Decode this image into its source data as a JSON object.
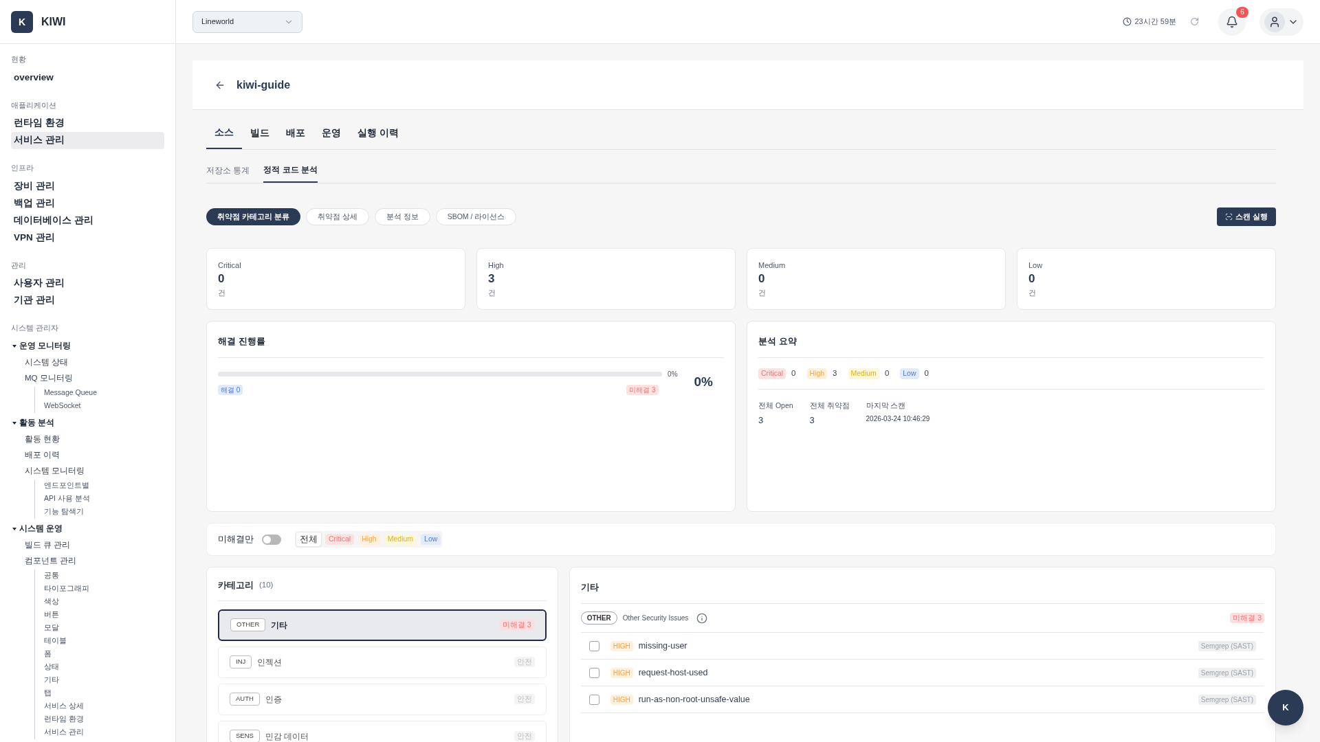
{
  "brand": {
    "logo": "K",
    "name": "KIWI"
  },
  "sidebar": [
    {
      "title": "현황",
      "items": [
        {
          "label": "overview",
          "selected": false
        }
      ]
    },
    {
      "title": "애플리케이션",
      "items": [
        {
          "label": "런타임 환경",
          "selected": false
        },
        {
          "label": "서비스 관리",
          "selected": true
        }
      ]
    },
    {
      "title": "인프라",
      "items": [
        {
          "label": "장비 관리",
          "selected": false
        },
        {
          "label": "백업 관리",
          "selected": false
        },
        {
          "label": "데이터베이스 관리",
          "selected": false
        },
        {
          "label": "VPN 관리",
          "selected": false
        }
      ]
    },
    {
      "title": "관리",
      "items": [
        {
          "label": "사용자 관리",
          "selected": false
        },
        {
          "label": "기관 관리",
          "selected": false
        }
      ]
    },
    {
      "title": "시스템 관리자",
      "groups": [
        {
          "label": "운영 모니터링",
          "expanded": true,
          "children": [
            {
              "label": "시스템 상태"
            },
            {
              "label": "MQ 모니터링",
              "children": [
                {
                  "label": "Message Queue"
                },
                {
                  "label": "WebSocket"
                }
              ]
            }
          ]
        },
        {
          "label": "활동 분석",
          "expanded": true,
          "children": [
            {
              "label": "활동 현황"
            },
            {
              "label": "배포 이력"
            },
            {
              "label": "시스템 모니터링",
              "children": [
                {
                  "label": "엔드포인트별"
                },
                {
                  "label": "API 사용 분석"
                },
                {
                  "label": "기능 탐색기"
                }
              ]
            }
          ]
        },
        {
          "label": "시스템 운영",
          "expanded": true,
          "children": [
            {
              "label": "빌드 큐 관리"
            },
            {
              "label": "컴포넌트 관리",
              "children": [
                {
                  "label": "공통"
                },
                {
                  "label": "타이포그래피"
                },
                {
                  "label": "색상"
                },
                {
                  "label": "버튼"
                },
                {
                  "label": "모달"
                },
                {
                  "label": "테이블"
                },
                {
                  "label": "폼"
                },
                {
                  "label": "상태"
                },
                {
                  "label": "기타"
                },
                {
                  "label": "탭"
                },
                {
                  "label": "서비스 상세"
                },
                {
                  "label": "런타임 환경"
                },
                {
                  "label": "서비스 관리"
                }
              ]
            }
          ]
        }
      ]
    }
  ],
  "header": {
    "org_select": "Lineworld",
    "session": "23시간 59분",
    "notifications": "6"
  },
  "page": {
    "title": "kiwi-guide"
  },
  "tabs": [
    {
      "label": "소스",
      "selected": true
    },
    {
      "label": "빌드",
      "selected": false
    },
    {
      "label": "배포",
      "selected": false
    },
    {
      "label": "운영",
      "selected": false
    },
    {
      "label": "실행 이력",
      "selected": false
    }
  ],
  "subtabs": [
    {
      "label": "저장소 통계",
      "selected": false
    },
    {
      "label": "정적 코드 분석",
      "selected": true
    }
  ],
  "pills": [
    {
      "label": "취약점 카테고리 분류",
      "selected": true
    },
    {
      "label": "취약점 상세",
      "selected": false
    },
    {
      "label": "분석 정보",
      "selected": false
    },
    {
      "label": "SBOM / 라이선스",
      "selected": false
    }
  ],
  "scan_button": "스캔 실행",
  "stats": [
    {
      "label": "Critical",
      "value": "0",
      "unit": "건"
    },
    {
      "label": "High",
      "value": "3",
      "unit": "건"
    },
    {
      "label": "Medium",
      "value": "0",
      "unit": "건"
    },
    {
      "label": "Low",
      "value": "0",
      "unit": "건"
    }
  ],
  "progress": {
    "title": "해결 진행률",
    "level": 0,
    "reading": "0%",
    "resolved": "해결 0",
    "unresolved": "미해결 3",
    "percent": "0%"
  },
  "summary": {
    "title": "분석 요약",
    "counts": [
      {
        "kind": "critical",
        "label": "Critical",
        "value": "0"
      },
      {
        "kind": "high",
        "label": "High",
        "value": "3"
      },
      {
        "kind": "medium",
        "label": "Medium",
        "value": "0"
      },
      {
        "kind": "low",
        "label": "Low",
        "value": "0"
      }
    ],
    "metrics": [
      {
        "label": "전체 Open",
        "value": "3"
      },
      {
        "label": "전체 취약점",
        "value": "3"
      },
      {
        "label": "마지막 스캔",
        "value": "2026-03-24 10:46:29"
      }
    ]
  },
  "filter": {
    "label": "미해결만",
    "on": false,
    "options": [
      {
        "kind": "all",
        "label": "전체",
        "selected": true
      },
      {
        "kind": "critical",
        "label": "Critical",
        "selected": false
      },
      {
        "kind": "high",
        "label": "High",
        "selected": false
      },
      {
        "kind": "medium",
        "label": "Medium",
        "selected": false
      },
      {
        "kind": "low",
        "label": "Low",
        "selected": false
      }
    ]
  },
  "categories": {
    "title": "카테고리",
    "count": "(10)",
    "items": [
      {
        "code": "OTHER",
        "name": "기타",
        "status": "미해결 3",
        "kind": "open",
        "selected": true
      },
      {
        "code": "INJ",
        "name": "인젝션",
        "status": "안전",
        "kind": "safe",
        "selected": false
      },
      {
        "code": "AUTH",
        "name": "인증",
        "status": "안전",
        "kind": "safe",
        "selected": false
      },
      {
        "code": "SENS",
        "name": "민감 데이터",
        "status": "안전",
        "kind": "safe",
        "selected": false
      }
    ]
  },
  "detail": {
    "title": "기타",
    "code": "OTHER",
    "description": "Other Security Issues",
    "status": "미해결 3",
    "issues": [
      {
        "severity": "HIGH",
        "kind": "high",
        "name": "missing-user",
        "tool": "Semgrep (SAST)",
        "checked": false
      },
      {
        "severity": "HIGH",
        "kind": "high",
        "name": "request-host-used",
        "tool": "Semgrep (SAST)",
        "checked": false
      },
      {
        "severity": "HIGH",
        "kind": "high",
        "name": "run-as-non-root-unsafe-value",
        "tool": "Semgrep (SAST)",
        "checked": false
      }
    ]
  },
  "chat_button": "K"
}
